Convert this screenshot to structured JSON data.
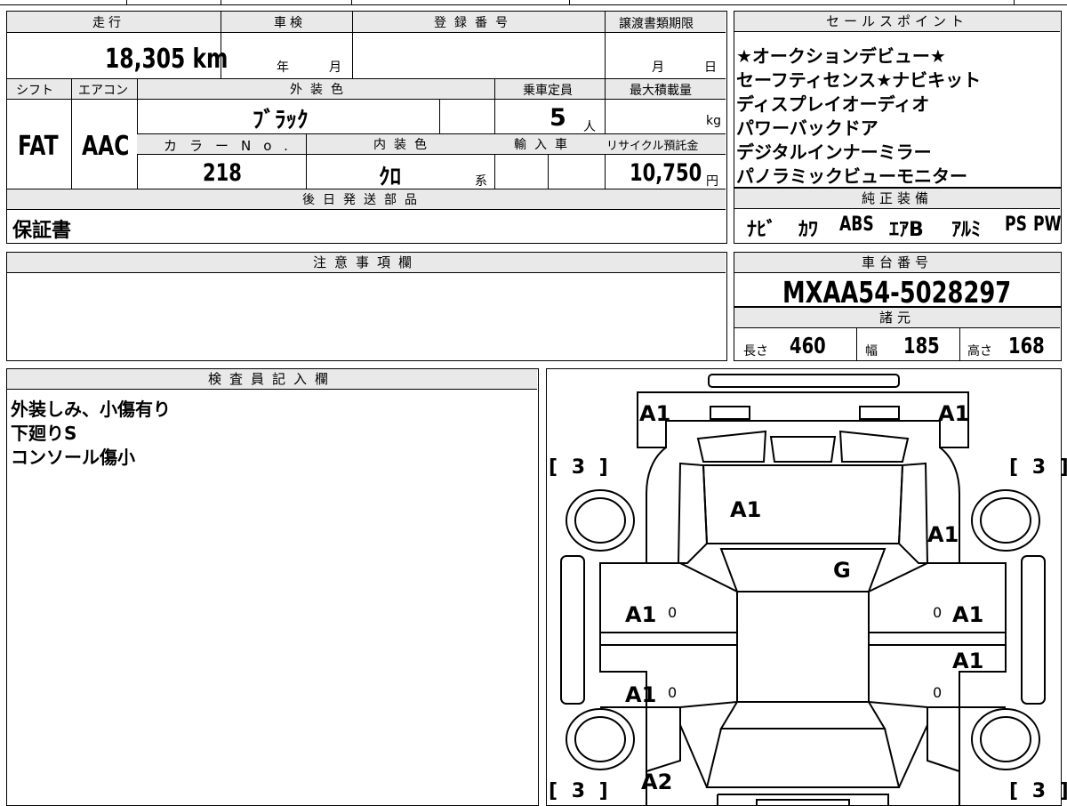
{
  "vehicle": {
    "mileage_label": "走行",
    "mileage_value": "18,305",
    "mileage_unit": "km",
    "inspection_label": "車検",
    "year_unit": "年",
    "month_unit": "月",
    "registration_label": "登録番号",
    "transfer_deadline_label": "譲渡書類期限",
    "deadline_month_unit": "月",
    "deadline_day_unit": "日",
    "shift_label": "シフト",
    "shift_value": "FAT",
    "aircon_label": "エアコン",
    "aircon_value": "AAC",
    "exterior_color_label": "外装色",
    "exterior_color_value": "ﾌﾞﾗｯｸ",
    "capacity_label": "乗車定員",
    "capacity_value": "5",
    "capacity_unit": "人",
    "max_load_label": "最大積載量",
    "max_load_unit": "kg",
    "color_no_label": "カラーNo.",
    "color_no_value": "218",
    "interior_color_label": "内装色",
    "interior_color_value": "ｸﾛ",
    "interior_suffix": "系",
    "import_label": "輸入車",
    "recycle_label": "リサイクル預託金",
    "recycle_value": "10,750",
    "recycle_unit": "円",
    "shipping_parts_label": "後日発送部品",
    "shipping_parts_value": "保証書"
  },
  "sales_points": {
    "header": "セールスポイント",
    "lines": [
      "★オークションデビュー★",
      "セーフティセンス★ナビキット",
      "ディスプレイオーディオ",
      "パワーバックドア",
      "デジタルインナーミラー",
      "パノラミックビューモニター"
    ]
  },
  "equipment": {
    "header": "純正装備",
    "items": [
      "ﾅﾋﾞ",
      "ｶﾜ",
      "ABS",
      "ｴｱB",
      "ｱﾙﾐ",
      "PS",
      "PW"
    ]
  },
  "notes": {
    "header": "注意事項欄",
    "content": ""
  },
  "chassis": {
    "header": "車台番号",
    "value": "MXAA54-5028297"
  },
  "specs": {
    "header": "諸元",
    "length_label": "長さ",
    "length_value": "460",
    "width_label": "幅",
    "width_value": "185",
    "height_label": "高さ",
    "height_value": "168"
  },
  "inspector": {
    "header": "検査員記入欄",
    "lines": [
      "外装しみ、小傷有り",
      "下廻りS",
      "コンソール傷小"
    ]
  },
  "diagram": {
    "labels": {
      "front_left": "A1",
      "front_right": "A1",
      "hood": "A1",
      "right_fender": "A1",
      "windshield": "G",
      "left_front_door": "A1",
      "right_front_door": "A1",
      "right_rear_door": "A1",
      "left_rear_door": "A1",
      "rear": "A2",
      "tire_fl": "[ 3 ]",
      "tire_fr": "[ 3 ]",
      "tire_rl": "[ 3 ]",
      "tire_rr": "[ 3 ]",
      "mark_lf": "0",
      "mark_rf": "0",
      "mark_lr": "0",
      "mark_rr": "0"
    }
  }
}
